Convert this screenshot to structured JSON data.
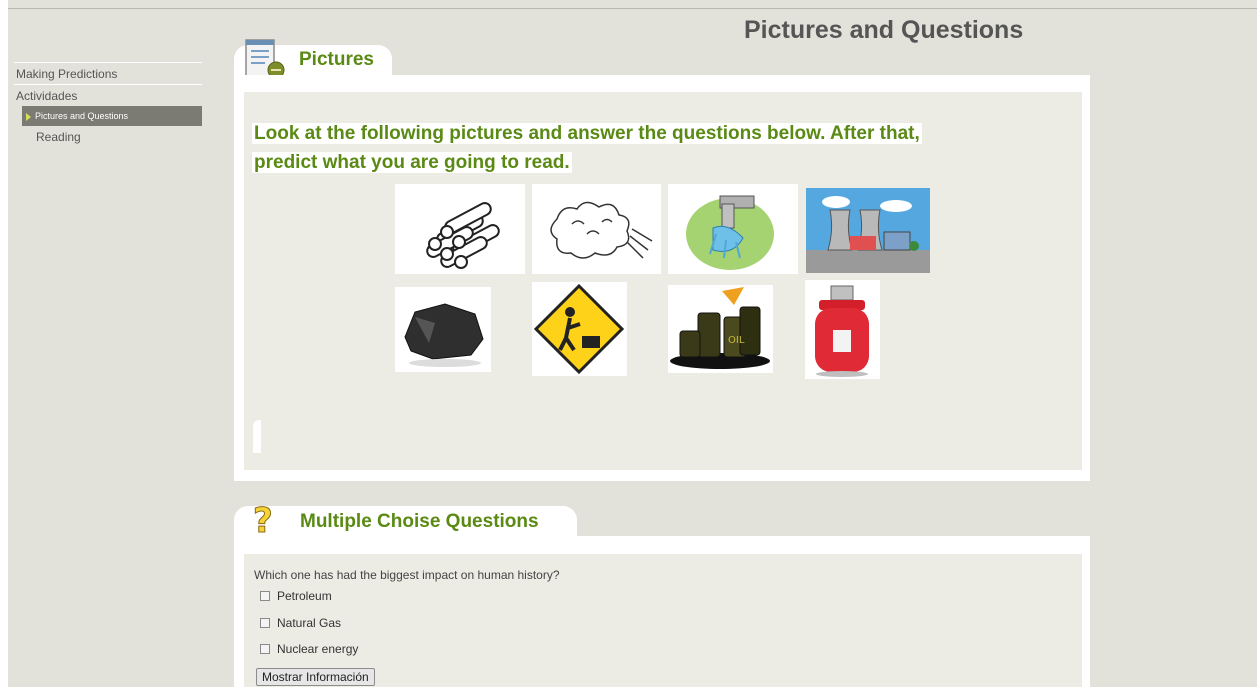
{
  "page": {
    "title": "Pictures and Questions"
  },
  "sidebar": {
    "items": [
      {
        "label": "Making Predictions"
      },
      {
        "label": "Actividades"
      },
      {
        "label": "Pictures and Questions",
        "active": true
      },
      {
        "label": "Reading"
      }
    ]
  },
  "pictures": {
    "tab_title": "Pictures",
    "tab_icon": "notepad-icon",
    "instructions_line1": "Look at the following pictures and answer the questions below. After that,",
    "instructions_line2": "predict what you are going to read.",
    "images": [
      "logs",
      "wind",
      "water-faucet",
      "power-plant",
      "coal",
      "worker-sign",
      "oil-barrels",
      "gas-cylinder"
    ]
  },
  "questions": {
    "tab_title": "Multiple Choise Questions",
    "tab_icon": "question-mark-icon",
    "question": "Which one has had the biggest impact on human history?",
    "options": [
      "Petroleum",
      "Natural Gas",
      "Nuclear energy"
    ],
    "button_label": "Mostrar Información"
  },
  "colors": {
    "accent": "#5a8a14",
    "background": "#e3e2da",
    "nav_active": "#7b7b73"
  }
}
